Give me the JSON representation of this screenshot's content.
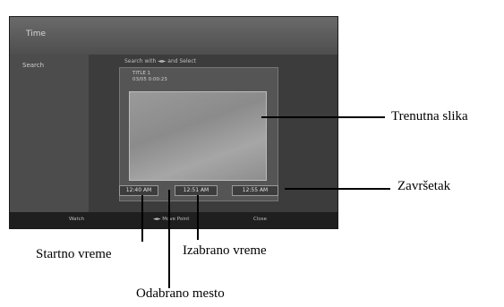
{
  "screen": {
    "title": "Time",
    "sidebar_label": "Search",
    "instruction": "Search with ◄► and Select",
    "title_line1": "TITLE 1",
    "title_line2": "03/05   0:00:23",
    "start_time": "12:40 AM",
    "selected_time": "12:51 AM",
    "end_time": "12:55 AM",
    "hint_watch": "Watch",
    "hint_move": "◄► Move Point",
    "hint_close": "Close"
  },
  "callouts": {
    "current_image": "Trenutna slika",
    "end": "Završetak",
    "start_time": "Startno vreme",
    "selected_time": "Izabrano vreme",
    "selected_place": "Odabrano mesto"
  }
}
